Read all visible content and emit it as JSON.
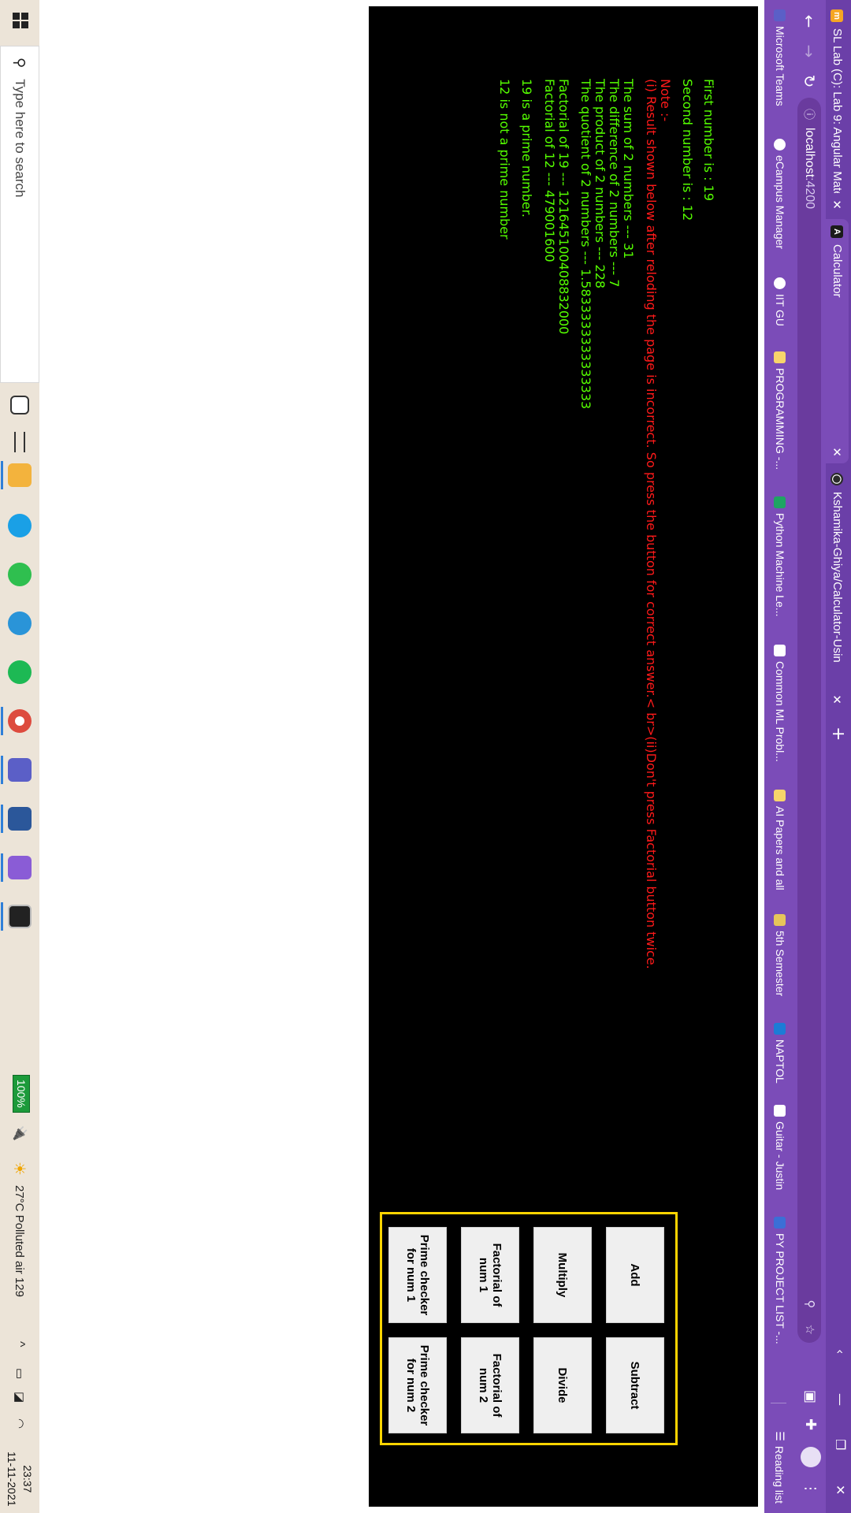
{
  "browser": {
    "tabs": [
      {
        "title": "SL Lab (C): Lab 9: Angular Materi",
        "favicon_icon": "moodle-icon"
      },
      {
        "title": "Calculator",
        "favicon_icon": "angular-icon"
      },
      {
        "title": "Kshamika-Ghiya/Calculator-Usin",
        "favicon_icon": "github-icon"
      }
    ],
    "url_host": "localhost",
    "url_port": ":4200",
    "bookmarks": [
      "Microsoft Teams",
      "eCampus Manager",
      "IIT GU",
      "PROGRAMMING -...",
      "Python Machine Le...",
      "Common ML Probl...",
      "AI Papers and all",
      "5th Semester",
      "NAPTOL",
      "Guitar - Justin",
      "PY PROJECT LIST -..."
    ],
    "reading_list": "Reading list"
  },
  "output": {
    "first": "First number is : 19",
    "second": "Second number is : 12",
    "note_title": "Note :-",
    "note_body": "(i) Result shown below after reloding the page is incorrect. So press the button for correct answer.< br>(ii)Don't press Factorial button twice.",
    "sum": "The sum of 2 numbers --- 31",
    "difference": "The difference of 2 numbers --- 7",
    "product": "The product of 2 numbers --- 228",
    "quotient": "The quotient of 2 numbers --- 1.5833333333333333",
    "fact1": "Factorial of 19 --- 121645100408832000",
    "fact2": "Factorial of 12 --- 479001600",
    "prime1": "19 is a prime number.",
    "prime2": "12 is not a prime number"
  },
  "buttons": {
    "add": "Add",
    "subtract": "Subtract",
    "multiply": "Multiply",
    "divide": "Divide",
    "fact1": "Factorial of num 1",
    "fact2": "Factorial of num 2",
    "prime1": "Prime checker for num 1",
    "prime2": "Prime checker for num 2"
  },
  "taskbar": {
    "search_placeholder": "Type here to search",
    "battery": "100%",
    "weather": "27°C  Polluted air 129",
    "time": "23:37",
    "date": "11-11-2021"
  },
  "colors": {
    "browser_accent": "#7b4cb8",
    "result_text": "#55ff00",
    "note_text": "#ff1a1a",
    "panel_border": "#ffd400"
  }
}
